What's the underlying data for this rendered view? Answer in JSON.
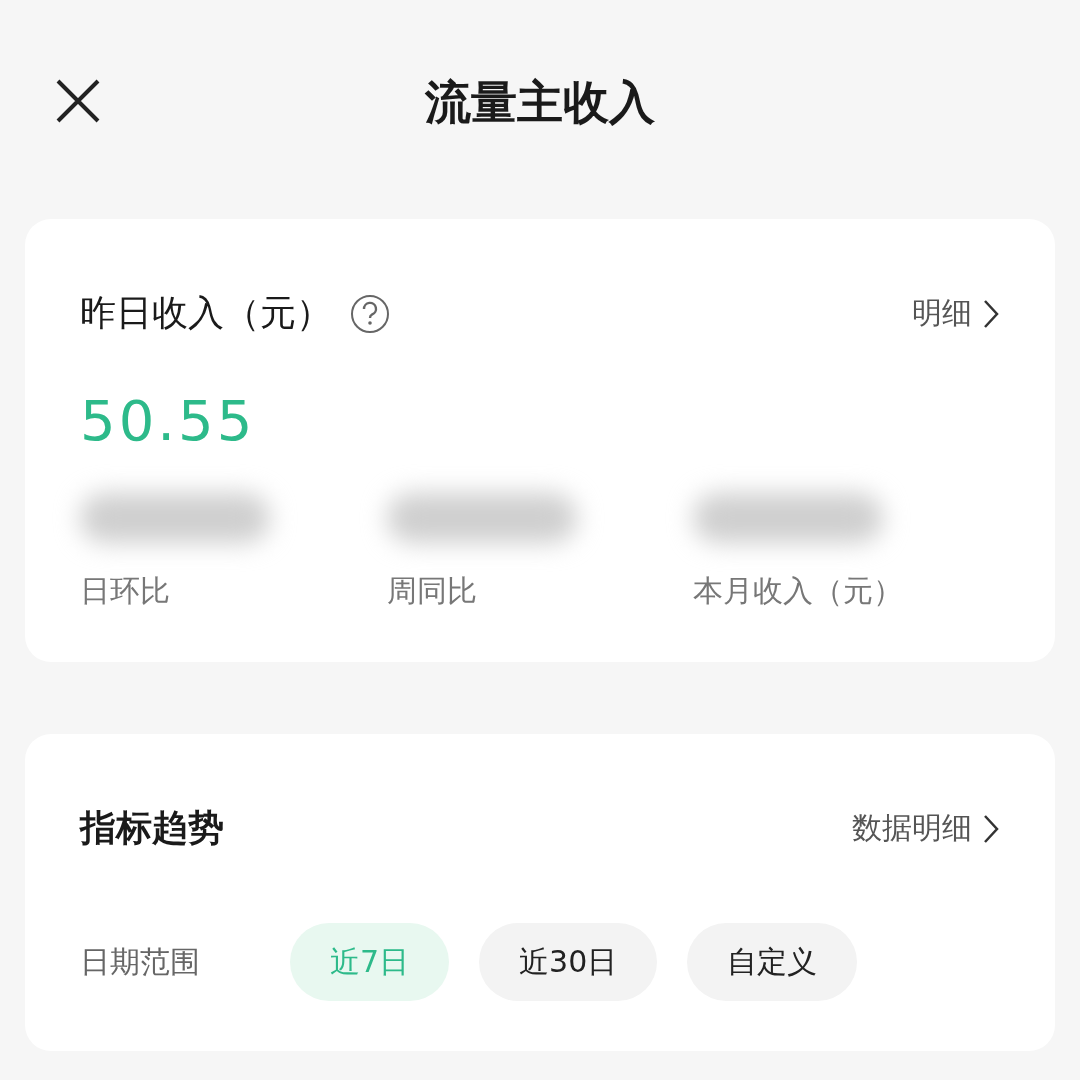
{
  "header": {
    "title": "流量主收入"
  },
  "income_card": {
    "title": "昨日收入（元）",
    "detail_link": "明细",
    "amount": "50.55",
    "stats": [
      {
        "label": "日环比",
        "blurred": true
      },
      {
        "label": "周同比",
        "blurred": true
      },
      {
        "label": "本月收入（元）",
        "blurred": true
      }
    ]
  },
  "trend_card": {
    "title": "指标趋势",
    "detail_link": "数据明细",
    "range_label": "日期范围",
    "ranges": [
      {
        "label": "近7日",
        "selected": true
      },
      {
        "label": "近30日",
        "selected": false
      },
      {
        "label": "自定义",
        "selected": false
      }
    ]
  }
}
